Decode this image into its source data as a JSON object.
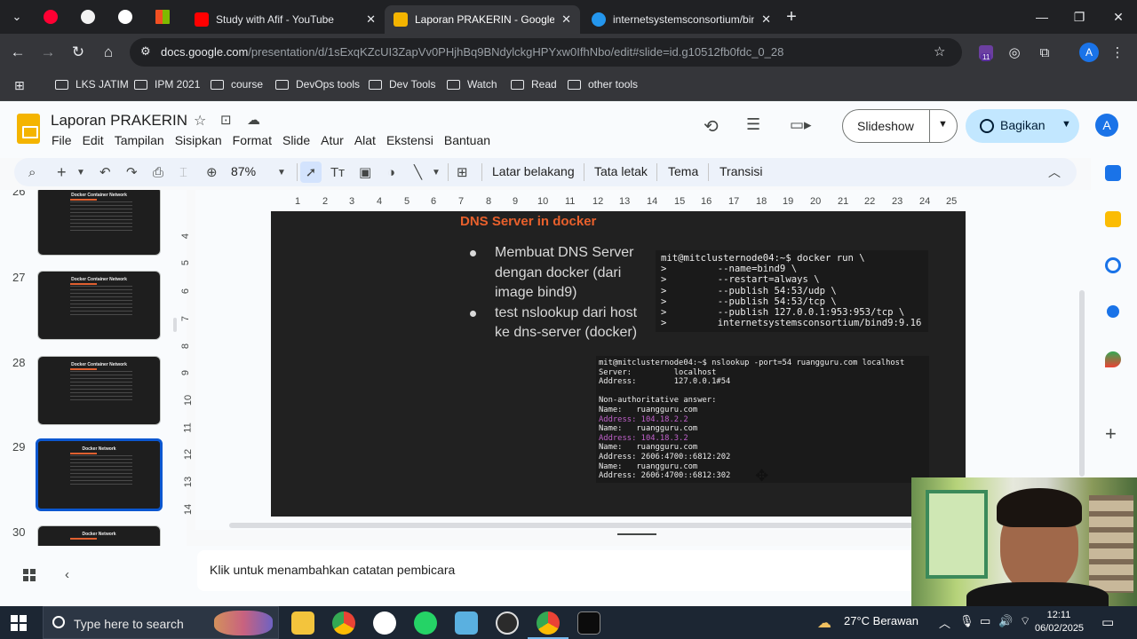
{
  "browser": {
    "tabs": [
      {
        "title": "Study with Afif - YouTube",
        "color": "#ff0000"
      },
      {
        "title": "Laporan PRAKERIN - Google Sli",
        "color": "#f4b400"
      },
      {
        "title": "internetsystemsconsortium/bin",
        "color": "#2496ed"
      }
    ],
    "url_host": "docs.google.com",
    "url_path": "/presentation/d/1sExqKZcUI3ZapVv0PHjhBq9BNdylckgHPYxw0IfhNbo/edit#slide=id.g10512fb0fdc_0_28",
    "profile_initial": "A",
    "ext_badge": "11",
    "bookmarks": [
      "LKS JATIM",
      "IPM 2021",
      "course",
      "DevOps tools",
      "Dev Tools",
      "Watch",
      "Read",
      "other tools"
    ]
  },
  "app": {
    "doc_title": "Laporan PRAKERIN",
    "menu": [
      "File",
      "Edit",
      "Tampilan",
      "Sisipkan",
      "Format",
      "Slide",
      "Atur",
      "Alat",
      "Ekstensi",
      "Bantuan"
    ],
    "slideshow_label": "Slideshow",
    "share_label": "Bagikan",
    "account_initial": "A"
  },
  "toolbar": {
    "zoom": "87%",
    "background": "Latar belakang",
    "layout": "Tata letak",
    "theme": "Tema",
    "transition": "Transisi"
  },
  "ruler": {
    "h": [
      "1",
      "2",
      "3",
      "4",
      "5",
      "6",
      "7",
      "8",
      "9",
      "10",
      "11",
      "12",
      "13",
      "14",
      "15",
      "16",
      "17",
      "18",
      "19",
      "20",
      "21",
      "22",
      "23",
      "24",
      "25"
    ],
    "v": [
      "4",
      "5",
      "6",
      "7",
      "8",
      "9",
      "10",
      "11",
      "12",
      "13",
      "14"
    ]
  },
  "filmstrip": {
    "slides": [
      {
        "num": "26",
        "title": "Docker Container Network"
      },
      {
        "num": "27",
        "title": "Docker Container Network"
      },
      {
        "num": "28",
        "title": "Docker Container Network"
      },
      {
        "num": "29",
        "title": "Docker Network"
      },
      {
        "num": "30",
        "title": "Docker Network"
      }
    ]
  },
  "slide": {
    "title": "DNS Server in docker",
    "bullets": [
      "Membuat DNS Server dengan docker (dari image bind9)",
      "test nslookup dari host ke dns-server (docker)"
    ],
    "term1": [
      "mit@mitclusternode04:~$ docker run \\",
      ">         --name=bind9 \\",
      ">         --restart=always \\",
      ">         --publish 54:53/udp \\",
      ">         --publish 54:53/tcp \\",
      ">         --publish 127.0.0.1:953:953/tcp \\",
      ">         internetsystemsconsortium/bind9:9.16"
    ],
    "term2": [
      "mit@mitclusternode04:~$ nslookup -port=54 ruangguru.com localhost",
      "Server:         localhost",
      "Address:        127.0.0.1#54",
      "",
      "Non-authoritative answer:",
      "Name:   ruangguru.com",
      "Address: 104.18.2.2",
      "Name:   ruangguru.com",
      "Address: 104.18.3.2",
      "Name:   ruangguru.com",
      "Address: 2606:4700::6812:202",
      "Name:   ruangguru.com",
      "Address: 2606:4700::6812:302"
    ]
  },
  "notes": {
    "placeholder": "Klik untuk menambahkan catatan pembicara"
  },
  "taskbar": {
    "search_placeholder": "Type here to search",
    "weather": "27°C  Berawan",
    "time": "12:11",
    "date": "06/02/2025"
  }
}
